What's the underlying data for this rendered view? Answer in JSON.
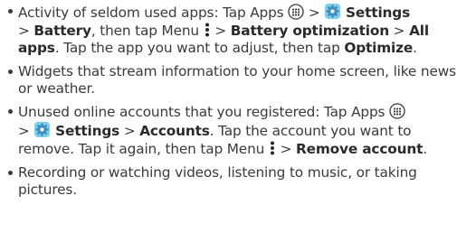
{
  "tips": {
    "t1": {
      "a": "Activity of seldom used apps: Tap Apps",
      "b": ">",
      "c": "Settings",
      "d": "> ",
      "e": "Battery",
      "f": ", then tap Menu",
      "g": "> ",
      "h": "Battery optimization",
      "i": " > ",
      "j": "All apps",
      "k": ". Tap the app you want to adjust, then tap ",
      "l": "Optimize",
      "m": "."
    },
    "t2": {
      "a": "Widgets that stream information to your home screen, like news or weather."
    },
    "t3": {
      "a": "Unused online accounts that you registered: Tap Apps",
      "b": ">",
      "c": "Settings",
      "d": " > ",
      "e": "Accounts",
      "f": ". Tap the account you want to remove. Tap it again, then tap Menu",
      "g": "> ",
      "h": "Remove account",
      "i": "."
    },
    "t4": {
      "a": "Recording or watching videos, listening to music, or taking pictures."
    }
  },
  "icons": {
    "apps": "apps-icon",
    "settings": "settings-gear-icon",
    "menu": "menu-more-vert-icon"
  },
  "colors": {
    "text": "#3a3a3a",
    "settings_gear": "#4a9bc9",
    "settings_bg": "#7fd0ea"
  }
}
